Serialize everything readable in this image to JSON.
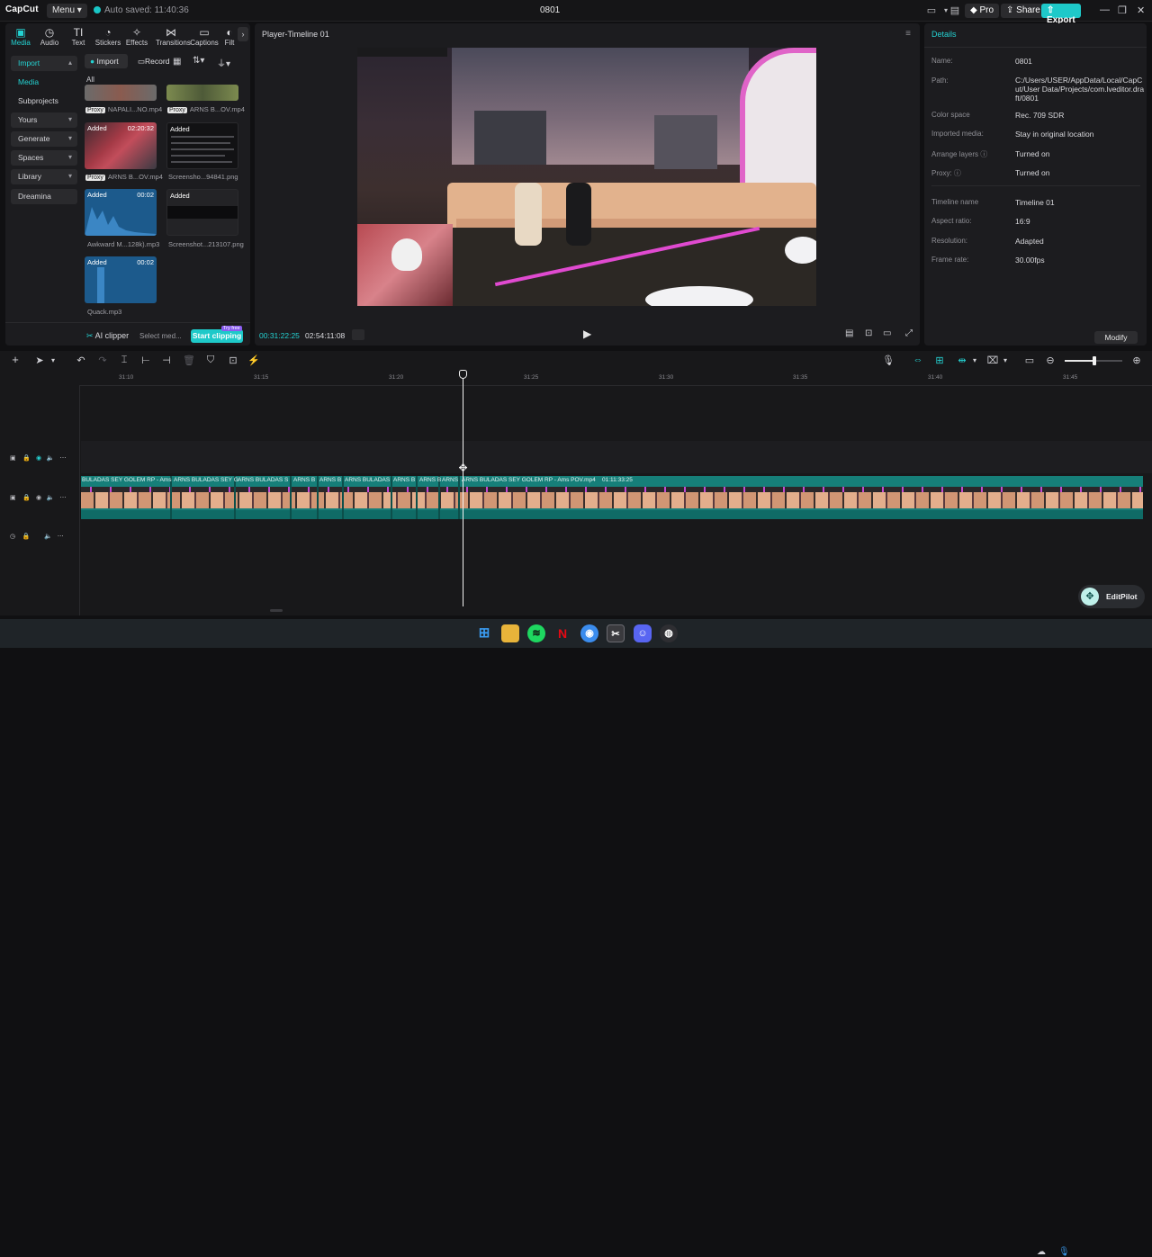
{
  "titlebar": {
    "logo": "CapCut",
    "menu_label": "Menu",
    "auto_saved": "Auto saved: 11:40:36",
    "project_title": "0801",
    "pro_label": "Pro",
    "share_label": "Share",
    "export_label": "Export"
  },
  "media_tabs": [
    {
      "label": "Media",
      "icon": "media-icon"
    },
    {
      "label": "Audio",
      "icon": "audio-icon"
    },
    {
      "label": "Text",
      "icon": "text-icon"
    },
    {
      "label": "Stickers",
      "icon": "stickers-icon"
    },
    {
      "label": "Effects",
      "icon": "effects-icon"
    },
    {
      "label": "Transitions",
      "icon": "transitions-icon"
    },
    {
      "label": "Captions",
      "icon": "captions-icon"
    },
    {
      "label": "Filt",
      "icon": "filters-icon"
    }
  ],
  "sidebar": {
    "items": [
      {
        "label": "Import"
      },
      {
        "label": "Media"
      },
      {
        "label": "Subprojects"
      },
      {
        "label": "Yours"
      },
      {
        "label": "Generate"
      },
      {
        "label": "Spaces"
      },
      {
        "label": "Library"
      },
      {
        "label": "Dreamina"
      }
    ]
  },
  "media_toolbar": {
    "import_label": "Import",
    "record_label": "Record",
    "filter_all": "All"
  },
  "media_items": [
    {
      "name": "NAPALI...NO.mp4",
      "proxy": "Proxy",
      "status": "",
      "duration": ""
    },
    {
      "name": "ARNS B...OV.mp4",
      "proxy": "Proxy",
      "status": "",
      "duration": ""
    },
    {
      "name": "ARNS B...OV.mp4",
      "proxy": "Proxy",
      "status": "Added",
      "duration": "02:20:32"
    },
    {
      "name": "Screensho...94841.png",
      "proxy": "",
      "status": "Added",
      "duration": ""
    },
    {
      "name": "Awkward M...128k).mp3",
      "proxy": "",
      "status": "Added",
      "duration": "00:02"
    },
    {
      "name": "Screenshot...213107.png",
      "proxy": "",
      "status": "Added",
      "duration": ""
    },
    {
      "name": "Quack.mp3",
      "proxy": "",
      "status": "Added",
      "duration": "00:02"
    }
  ],
  "bottom_bar": {
    "ai_clipper": "AI clipper",
    "select_media": "Select med...",
    "start_clipping": "Start clipping",
    "try_free": "Try free"
  },
  "player": {
    "title": "Player-Timeline 01",
    "current_time": "00:31:22:25",
    "total_time": "02:54:11:08"
  },
  "details": {
    "title": "Details",
    "rows": [
      {
        "key": "Name:",
        "value": "0801"
      },
      {
        "key": "Path:",
        "value": "C:/Users/USER/AppData/Local/CapCut/User Data/Projects/com.lveditor.draft/0801"
      },
      {
        "key": "Color space",
        "value": "Rec. 709 SDR"
      },
      {
        "key": "Imported media:",
        "value": "Stay in original location"
      },
      {
        "key": "Arrange layers",
        "value": "Turned on"
      },
      {
        "key": "Proxy:",
        "value": "Turned on"
      },
      {
        "key": "Timeline name",
        "value": "Timeline 01"
      },
      {
        "key": "Aspect ratio:",
        "value": "16:9"
      },
      {
        "key": "Resolution:",
        "value": "Adapted"
      },
      {
        "key": "Frame rate:",
        "value": "30.00fps"
      }
    ],
    "modify_label": "Modify"
  },
  "timeline": {
    "ticks": [
      "31:10",
      "31:15",
      "31:20",
      "31:25",
      "31:30",
      "31:35",
      "31:40",
      "31:45"
    ],
    "clip_labels": [
      "BULADAS SEY GOLEM RP - Ams",
      "ARNS BULADAS SEY G",
      "ARNS BULADAS S",
      "ARNS B",
      "ARNS B",
      "ARNS BULADAS",
      "ARNS B",
      "ARNS B",
      "ARNS",
      "ARNS BULADAS SEY GOLEM RP - Ams POV.mp4",
      "01:11:33:25"
    ]
  },
  "editpilot_label": "EditPilot",
  "colors": {
    "accent": "#1ec9c9",
    "clip": "#167f79",
    "panel": "#1c1c1f"
  }
}
